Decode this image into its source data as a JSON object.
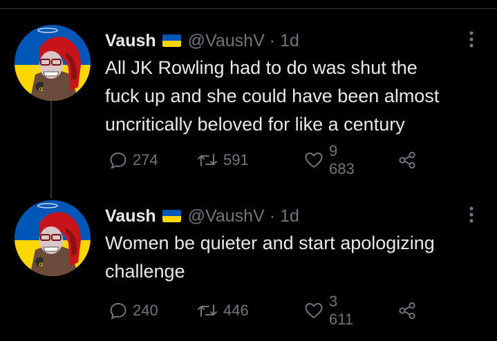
{
  "colors": {
    "background": "#000000",
    "text_primary": "#e7e9ea",
    "text_secondary": "#71767b",
    "divider": "#2f3336",
    "flag_blue": "#0057b7",
    "flag_yellow": "#ffd700"
  },
  "icons": [
    "avatar",
    "ukraine-flag-icon",
    "more-icon",
    "reply-icon",
    "retweet-icon",
    "like-icon",
    "share-icon"
  ],
  "tweets": [
    {
      "author_name": "Vaush",
      "handle": "@VaushV",
      "separator": "·",
      "time": "1d",
      "text": "All JK Rowling had to do was shut the\nfuck up and she could have been almost\nuncritically beloved for like a century",
      "replies": "274",
      "retweets": "591",
      "likes": "9 683"
    },
    {
      "author_name": "Vaush",
      "handle": "@VaushV",
      "separator": "·",
      "time": "1d",
      "text": "Women be quieter and start apologizing\nchallenge",
      "replies": "240",
      "retweets": "446",
      "likes": "3 611"
    }
  ]
}
